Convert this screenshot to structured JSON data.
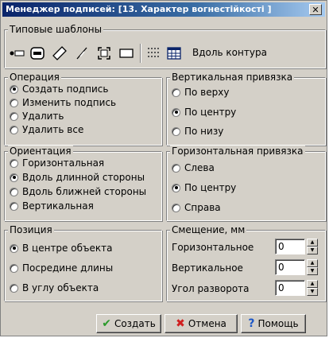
{
  "window": {
    "title": "Менеджер подписей: [13. Характер вогнестійкості ]",
    "close": "✕"
  },
  "templates": {
    "title": "Типовые шаблоны",
    "tools": [
      "dot-line-icon",
      "rounded-rect-icon",
      "diamond-icon",
      "diagonal-line-icon",
      "bracket-frame-icon",
      "rectangle-icon",
      "dotted-grid-icon",
      "table-grid-icon"
    ],
    "contour_label": "Вдоль контура"
  },
  "operation": {
    "title": "Операция",
    "options": [
      "Создать подпись",
      "Изменить подпись",
      "Удалить",
      "Удалить все"
    ],
    "selected": 0
  },
  "vertical": {
    "title": "Вертикальная привязка",
    "options": [
      "По верху",
      "По центру",
      "По низу"
    ],
    "selected": 1
  },
  "orientation": {
    "title": "Ориентация",
    "options": [
      "Горизонтальная",
      "Вдоль длинной стороны",
      "Вдоль ближней стороны",
      "Вертикальная"
    ],
    "selected": 1
  },
  "horizontal": {
    "title": "Горизонтальная привязка",
    "options": [
      "Слева",
      "По центру",
      "Справа"
    ],
    "selected": 1
  },
  "position": {
    "title": "Позиция",
    "options": [
      "В центре объекта",
      "Посредине длины",
      "В углу объекта"
    ],
    "selected": 0
  },
  "offset": {
    "title": "Смещение, мм",
    "fields": [
      {
        "label": "Горизонтальное",
        "value": "0"
      },
      {
        "label": "Вертикальное",
        "value": "0"
      },
      {
        "label": "Угол разворота",
        "value": "0"
      }
    ]
  },
  "buttons": {
    "create": "Создать",
    "cancel": "Отмена",
    "help": "Помощь"
  },
  "colors": {
    "face": "#d4d0c8",
    "title_start": "#0a246a",
    "create_check": "#2a9a2a",
    "cancel_x": "#d02020",
    "help_q": "#1a56c8"
  }
}
